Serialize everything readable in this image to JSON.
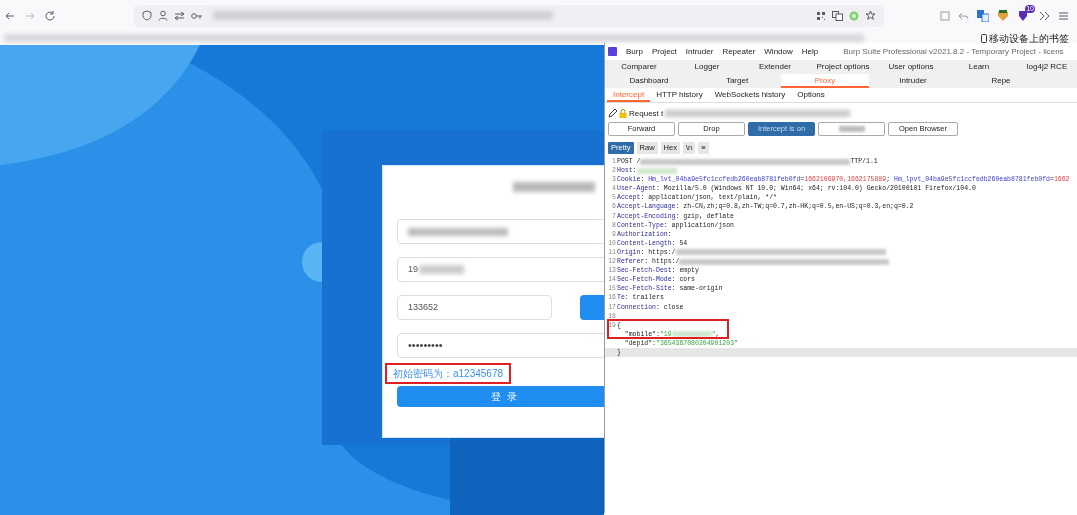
{
  "browser": {
    "bookmark_folder": "移动设备上的书签",
    "extension_badge": "10"
  },
  "login": {
    "fields": [
      {
        "kind": "redacted"
      },
      {
        "kind": "phone",
        "value": "19"
      },
      {
        "kind": "code",
        "value": "133652"
      },
      {
        "kind": "password",
        "value": "•••••••••"
      }
    ],
    "hint": "初始密码为：a12345678",
    "button": "登录"
  },
  "burp": {
    "menu": [
      "Burp",
      "Project",
      "Intruder",
      "Repeater",
      "Window",
      "Help"
    ],
    "title": "Burp Suite Professional v2021.8.2 - Temporary Project - licens",
    "tabs_row1": [
      {
        "label": "Comparer",
        "selected": false
      },
      {
        "label": "Logger",
        "selected": false
      },
      {
        "label": "Extender",
        "selected": false
      },
      {
        "label": "Project options",
        "selected": false
      },
      {
        "label": "User options",
        "selected": false
      },
      {
        "label": "Learn",
        "selected": false
      },
      {
        "label": "log4j2 RCE",
        "selected": false
      }
    ],
    "tabs_row2": [
      {
        "label": "Dashboard",
        "selected": false
      },
      {
        "label": "Target",
        "selected": false
      },
      {
        "label": "Proxy",
        "selected": true
      },
      {
        "label": "Intruder",
        "selected": false
      },
      {
        "label": "Repe",
        "selected": false
      }
    ],
    "subtabs": [
      {
        "label": "Intercept",
        "selected": true
      },
      {
        "label": "HTTP history",
        "selected": false
      },
      {
        "label": "WebSockets history",
        "selected": false
      },
      {
        "label": "Options",
        "selected": false
      }
    ],
    "request_label": "Request t",
    "buttons": [
      {
        "label": "Forward",
        "kind": "plain"
      },
      {
        "label": "Drop",
        "kind": "plain"
      },
      {
        "label": "Intercept is on",
        "kind": "primary"
      },
      {
        "kind": "redacted"
      },
      {
        "label": "Open Browser",
        "kind": "plain"
      }
    ],
    "views": [
      {
        "label": "Pretty",
        "selected": true
      },
      {
        "label": "Raw",
        "selected": false
      },
      {
        "label": "Hex",
        "selected": false
      },
      {
        "label": "\\n",
        "selected": false
      },
      {
        "label": "≡",
        "selected": false
      }
    ],
    "lines": [
      {
        "number": "1",
        "segments": [
          {
            "kind": "plain",
            "text": "POST /"
          },
          {
            "kind": "redact_long"
          },
          {
            "kind": "plain",
            "text": "TTP/1.1"
          }
        ]
      },
      {
        "number": "2",
        "segments": [
          {
            "kind": "key",
            "text": "Host"
          },
          {
            "kind": "plain",
            "text": ":"
          },
          {
            "kind": "redact_short"
          }
        ]
      },
      {
        "number": "3",
        "segments": [
          {
            "kind": "key",
            "text": "Cookie"
          },
          {
            "kind": "plain",
            "text": ": "
          },
          {
            "kind": "name",
            "text": "Hm_lvt_04ba9e5fc1ccfedb260eab8781feb0fd"
          },
          {
            "kind": "plain",
            "text": "="
          },
          {
            "kind": "red",
            "text": "1662106970,1662175889"
          },
          {
            "kind": "plain",
            "text": "; "
          },
          {
            "kind": "name",
            "text": "Hm_lpvt_04ba9e5fc1ccfedb260eab8781feb0fd"
          },
          {
            "kind": "plain",
            "text": "="
          },
          {
            "kind": "red",
            "text": "1662"
          }
        ]
      },
      {
        "number": "4",
        "segments": [
          {
            "kind": "key",
            "text": "User-Agent"
          },
          {
            "kind": "plain",
            "text": ": Mozilla/5.0 (Windows NT 10.0; Win64; x64; rv:104.0) Gecko/20100101 Firefox/104.0"
          }
        ]
      },
      {
        "number": "5",
        "segments": [
          {
            "kind": "key",
            "text": "Accept"
          },
          {
            "kind": "plain",
            "text": ": application/json, text/plain, */*"
          }
        ]
      },
      {
        "number": "6",
        "segments": [
          {
            "kind": "key",
            "text": "Accept-Language"
          },
          {
            "kind": "plain",
            "text": ": zh-CN,zh;q=0.8,zh-TW;q=0.7,zh-HK;q=0.5,en-US;q=0.3,en;q=0.2"
          }
        ]
      },
      {
        "number": "7",
        "segments": [
          {
            "kind": "key",
            "text": "Accept-Encoding"
          },
          {
            "kind": "plain",
            "text": ": gzip, deflate"
          }
        ]
      },
      {
        "number": "8",
        "segments": [
          {
            "kind": "key",
            "text": "Content-Type"
          },
          {
            "kind": "plain",
            "text": ": application/json"
          }
        ]
      },
      {
        "number": "9",
        "segments": [
          {
            "kind": "key",
            "text": "Authorization"
          },
          {
            "kind": "plain",
            "text": ":"
          }
        ]
      },
      {
        "number": "10",
        "segments": [
          {
            "kind": "key",
            "text": "Content-Length"
          },
          {
            "kind": "plain",
            "text": ": 54"
          }
        ]
      },
      {
        "number": "11",
        "segments": [
          {
            "kind": "key",
            "text": "Origin"
          },
          {
            "kind": "plain",
            "text": ": https:/"
          },
          {
            "kind": "redact_long"
          }
        ]
      },
      {
        "number": "12",
        "segments": [
          {
            "kind": "key",
            "text": "Referer"
          },
          {
            "kind": "plain",
            "text": ": https:/"
          },
          {
            "kind": "redact_long"
          }
        ]
      },
      {
        "number": "13",
        "segments": [
          {
            "kind": "key",
            "text": "Sec-Fetch-Dest"
          },
          {
            "kind": "plain",
            "text": ": empty"
          }
        ]
      },
      {
        "number": "14",
        "segments": [
          {
            "kind": "key",
            "text": "Sec-Fetch-Mode"
          },
          {
            "kind": "plain",
            "text": ": cors"
          }
        ]
      },
      {
        "number": "15",
        "segments": [
          {
            "kind": "key",
            "text": "Sec-Fetch-Site"
          },
          {
            "kind": "plain",
            "text": ": same-origin"
          }
        ]
      },
      {
        "number": "16",
        "segments": [
          {
            "kind": "key",
            "text": "Te"
          },
          {
            "kind": "plain",
            "text": ": trailers"
          }
        ]
      },
      {
        "number": "17",
        "segments": [
          {
            "kind": "key",
            "text": "Connection"
          },
          {
            "kind": "plain",
            "text": ": close"
          }
        ]
      },
      {
        "number": "18"
      },
      {
        "number": "19",
        "segments": [
          {
            "kind": "plain",
            "text": "{"
          }
        ]
      },
      {
        "segments": [
          {
            "kind": "plain",
            "text": "  \"mobile\":"
          },
          {
            "kind": "green",
            "text": "\"19"
          },
          {
            "kind": "redact_short"
          },
          {
            "kind": "green",
            "text": "\""
          },
          {
            "kind": "plain",
            "text": ","
          }
        ],
        "highlighted": true
      },
      {
        "segments": [
          {
            "kind": "plain",
            "text": "  \"depid\":"
          },
          {
            "kind": "green",
            "text": "\"3654367080204901203\""
          }
        ]
      },
      {
        "segments": [
          {
            "kind": "plain",
            "text": "}"
          }
        ],
        "current": true
      }
    ]
  }
}
